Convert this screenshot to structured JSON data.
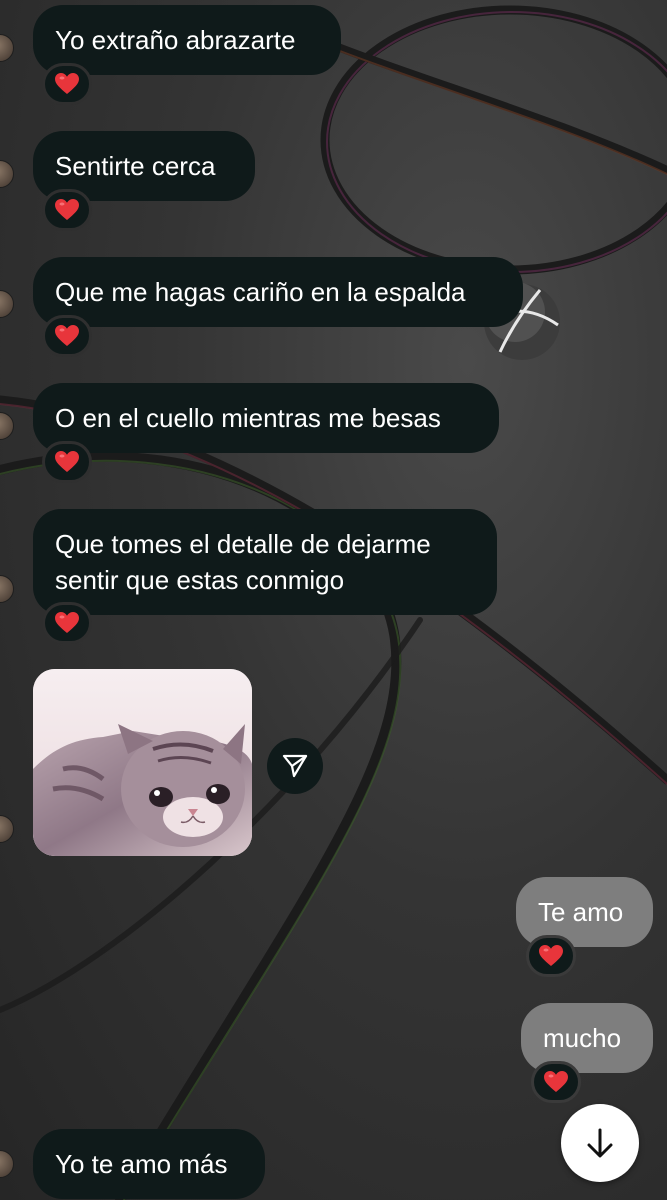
{
  "messages": [
    {
      "text": "Yo extraño abrazarte",
      "direction": "incoming",
      "reaction": "heart-emoji"
    },
    {
      "text": "Sentirte cerca",
      "direction": "incoming",
      "reaction": "heart-emoji"
    },
    {
      "text": "Que me hagas cariño en la espalda",
      "direction": "incoming",
      "reaction": "heart-emoji"
    },
    {
      "text": "O en el cuello mientras me besas",
      "direction": "incoming",
      "reaction": "heart-emoji"
    },
    {
      "text": "Que tomes el detalle de dejarme sentir que estas conmigo",
      "direction": "incoming",
      "reaction": "heart-emoji"
    },
    {
      "text": "",
      "direction": "incoming",
      "type": "photo",
      "photo_subject": "sad-kitten-image"
    },
    {
      "text": "Te amo",
      "direction": "outgoing",
      "reaction": "heart-emoji"
    },
    {
      "text": "mucho",
      "direction": "outgoing",
      "reaction": "heart-emoji"
    },
    {
      "text": "Yo te amo más",
      "direction": "incoming"
    }
  ],
  "icons": {
    "share": "paper-plane-icon",
    "scroll_down": "arrow-down-icon",
    "reaction": "red-heart-emoji"
  },
  "colors": {
    "incoming_bubble": "#0f1a1a",
    "outgoing_bubble": "#7e7e7e",
    "heart": "#e8353b",
    "scroll_button": "#ffffff"
  }
}
